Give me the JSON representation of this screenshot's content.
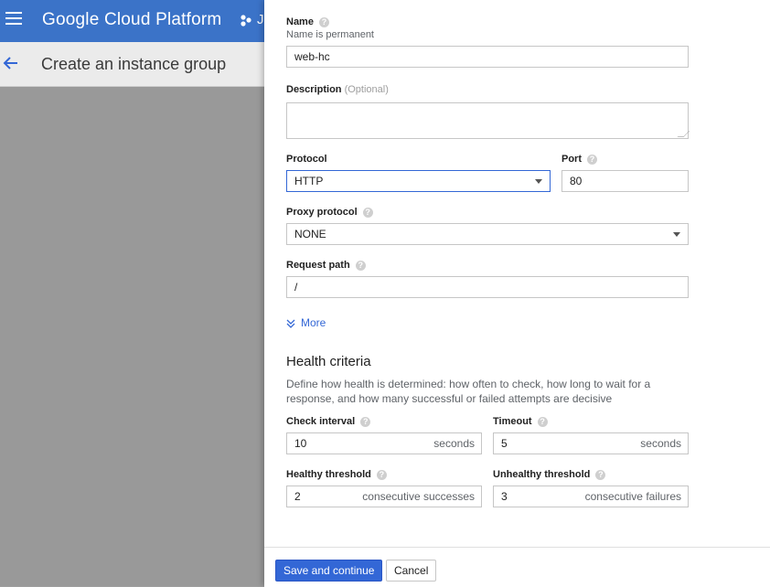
{
  "app": {
    "brand": "Google Cloud Platform",
    "project_initial": "J"
  },
  "page": {
    "title": "Create an instance group"
  },
  "form": {
    "name": {
      "label": "Name",
      "hint": "Name is permanent",
      "value": "web-hc"
    },
    "description": {
      "label": "Description",
      "optional": "(Optional)",
      "value": ""
    },
    "protocol": {
      "label": "Protocol",
      "value": "HTTP"
    },
    "port": {
      "label": "Port",
      "value": "80"
    },
    "proxy_protocol": {
      "label": "Proxy protocol",
      "value": "NONE"
    },
    "request_path": {
      "label": "Request path",
      "value": "/"
    },
    "more_label": "More"
  },
  "health": {
    "title": "Health criteria",
    "description": "Define how health is determined: how often to check, how long to wait for a response, and how many successful or failed attempts are decisive",
    "check_interval": {
      "label": "Check interval",
      "value": "10",
      "unit": "seconds"
    },
    "timeout": {
      "label": "Timeout",
      "value": "5",
      "unit": "seconds"
    },
    "healthy_threshold": {
      "label": "Healthy threshold",
      "value": "2",
      "unit": "consecutive successes"
    },
    "unhealthy_threshold": {
      "label": "Unhealthy threshold",
      "value": "3",
      "unit": "consecutive failures"
    }
  },
  "footer": {
    "save_label": "Save and continue",
    "cancel_label": "Cancel"
  },
  "help_glyph": "?",
  "colors": {
    "accent": "#3367d6",
    "topbar": "#3b73c8"
  }
}
